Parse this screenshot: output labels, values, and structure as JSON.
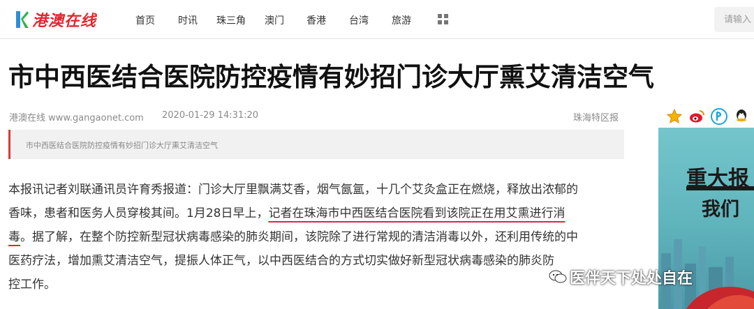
{
  "header": {
    "logo_text": "港澳在线",
    "nav": [
      "首页",
      "时讯",
      "珠三角",
      "澳门",
      "香港",
      "台湾",
      "旅游"
    ],
    "search_placeholder": "请输入"
  },
  "article": {
    "title": "市中西医结合医院防控疫情有妙招门诊大厅熏艾清洁空气",
    "site": "港澳在线 www.gangaonet.com",
    "datetime": "2020-01-29 14:31:20",
    "source": "珠海特区报",
    "summary": "市中西医结合医院防控疫情有妙招门诊大厅熏艾清洁空气",
    "body_lines": [
      {
        "pre": "本报讯记者刘联通讯员许育秀报道：门诊大厅里飘满艾香，烟气氤氲，十几个艾灸盒正在燃烧，释放出浓郁的",
        "ul": "",
        "post": ""
      },
      {
        "pre": "香味，患者和医务人员穿梭其间。1月28日早上，",
        "ul": "记者在珠海市中西医结合医院看到该院正在用艾熏进行消",
        "post": ""
      },
      {
        "pre": "",
        "ul": "毒",
        "post": "。据了解，在整个防控新型冠状病毒感染的肺炎期间，该院除了进行常规的清洁消毒以外，还利用传统的中"
      },
      {
        "pre": "医药疗法，增加熏艾清洁空气，提振人体正气，以中西医结合的方式切实做好新型冠状病毒感染的肺炎防",
        "ul": "",
        "post": ""
      },
      {
        "pre": "控工作。",
        "ul": "",
        "post": ""
      }
    ]
  },
  "sidebar": {
    "share_icons": [
      "star-icon",
      "weibo-icon",
      "qzone-icon",
      "qq-icon"
    ],
    "ad_title": "重大报",
    "ad_sub": "我们"
  },
  "watermark": {
    "text": "医伴天下处处自在"
  },
  "colors": {
    "brand_red": "#e0282f",
    "ad_teal": "#6fbfc6"
  }
}
